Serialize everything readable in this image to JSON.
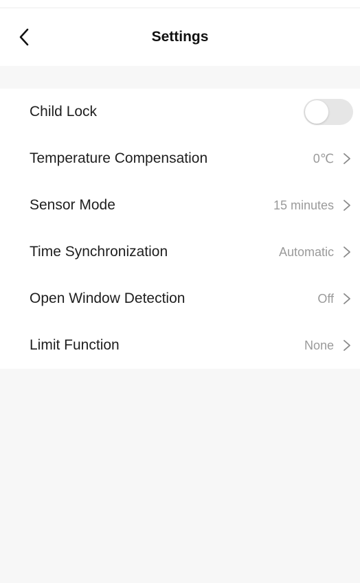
{
  "header": {
    "title": "Settings"
  },
  "settings": {
    "child_lock": {
      "label": "Child Lock",
      "enabled": false
    },
    "items": [
      {
        "label": "Temperature Compensation",
        "value": "0℃"
      },
      {
        "label": "Sensor Mode",
        "value": "15 minutes"
      },
      {
        "label": "Time Synchronization",
        "value": "Automatic"
      },
      {
        "label": "Open Window Detection",
        "value": "Off"
      },
      {
        "label": "Limit Function",
        "value": "None"
      }
    ]
  },
  "icons": {
    "back": "chevron-left-icon",
    "row_arrow": "chevron-right-icon"
  },
  "colors": {
    "background": "#f7f7f7",
    "card": "#ffffff",
    "label_text": "#1e1e1e",
    "value_text": "#9a9a9a",
    "toggle_off": "#e6e6e6"
  }
}
